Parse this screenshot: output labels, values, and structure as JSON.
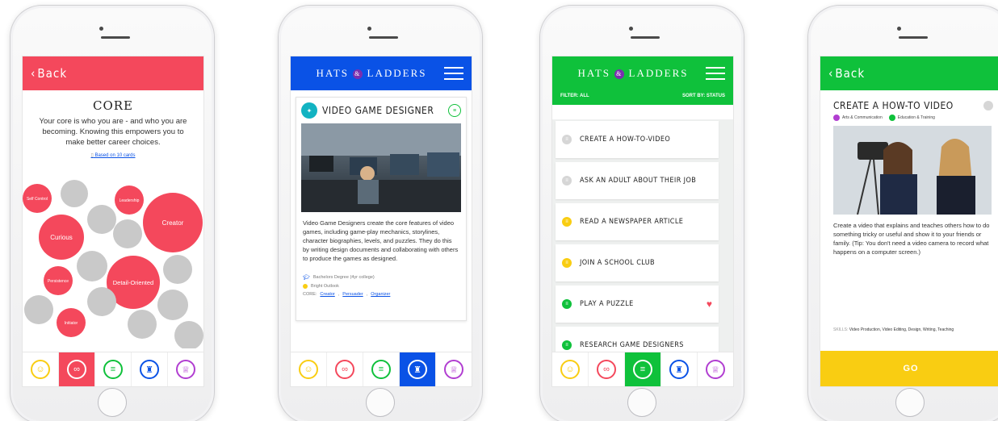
{
  "colors": {
    "red": "#f4485c",
    "blue": "#0a52e6",
    "green": "#0fc13b",
    "yellow": "#f9cd12",
    "purple": "#b13ed1",
    "grey": "#c9c9c9"
  },
  "tabs": [
    {
      "icon": "person-icon",
      "color": "#f9cd12"
    },
    {
      "icon": "core-circles-icon",
      "color": "#f4485c"
    },
    {
      "icon": "list-icon",
      "color": "#0fc13b"
    },
    {
      "icon": "hat-icon",
      "color": "#0a52e6"
    },
    {
      "icon": "trophy-icon",
      "color": "#b13ed1"
    }
  ],
  "screen1": {
    "back_label": "Back",
    "title": "CORE",
    "description": "Your core is who you are - and who you are becoming. Knowing this empowers you to make better career choices.",
    "based_on": "Based on 10 cards",
    "bubbles": {
      "self_control": "Self Control",
      "curious": "Curious",
      "leadership": "Leadership",
      "creator": "Creator",
      "persistence": "Persistence",
      "detail_oriented": "Detail-Oriented",
      "initiator": "Initiator"
    }
  },
  "screen2": {
    "logo_left": "HATS",
    "logo_amp": "&",
    "logo_right": "LADDERS",
    "career_title": "VIDEO GAME DESIGNER",
    "description": "Video Game Designers create the core features of video games, including game-play mechanics, storylines, character biographies, levels, and puzzles. They do this by writing design documents and collaborating with others to produce the games as designed.",
    "education": "Bachelors Degree (4yr college)",
    "outlook": "Bright Outlook",
    "core_label": "CORE:",
    "core_links": [
      "Creator",
      "Persuader",
      "Organizer"
    ]
  },
  "screen3": {
    "logo_left": "HATS",
    "logo_amp": "&",
    "logo_right": "LADDERS",
    "filter": "FILTER: ALL",
    "sort": "SORT BY: STATUS",
    "tasks": [
      {
        "label": "CREATE A HOW-TO-VIDEO",
        "status_color": "#d6d6d6"
      },
      {
        "label": "ASK AN ADULT ABOUT THEIR JOB",
        "status_color": "#d6d6d6"
      },
      {
        "label": "READ A NEWSPAPER ARTICLE",
        "status_color": "#f9cd12"
      },
      {
        "label": "JOIN A SCHOOL CLUB",
        "status_color": "#f9cd12"
      },
      {
        "label": "PLAY A PUZZLE",
        "status_color": "#0fc13b"
      },
      {
        "label": "RESEARCH GAME DESIGNERS",
        "status_color": "#0fc13b"
      }
    ]
  },
  "screen4": {
    "back_label": "Back",
    "title": "CREATE A HOW-TO VIDEO",
    "tag1": "Arts & Communication",
    "tag2": "Education & Training",
    "description": "Create a video that explains and teaches others how to do something tricky or useful and show it to your friends or family. (Tip: You don't need a video camera to record what happens on a computer screen.)",
    "skills_label": "SKILLS:",
    "skills": "Video Production, Video Editing, Design, Writing, Teaching",
    "go_label": "GO"
  }
}
